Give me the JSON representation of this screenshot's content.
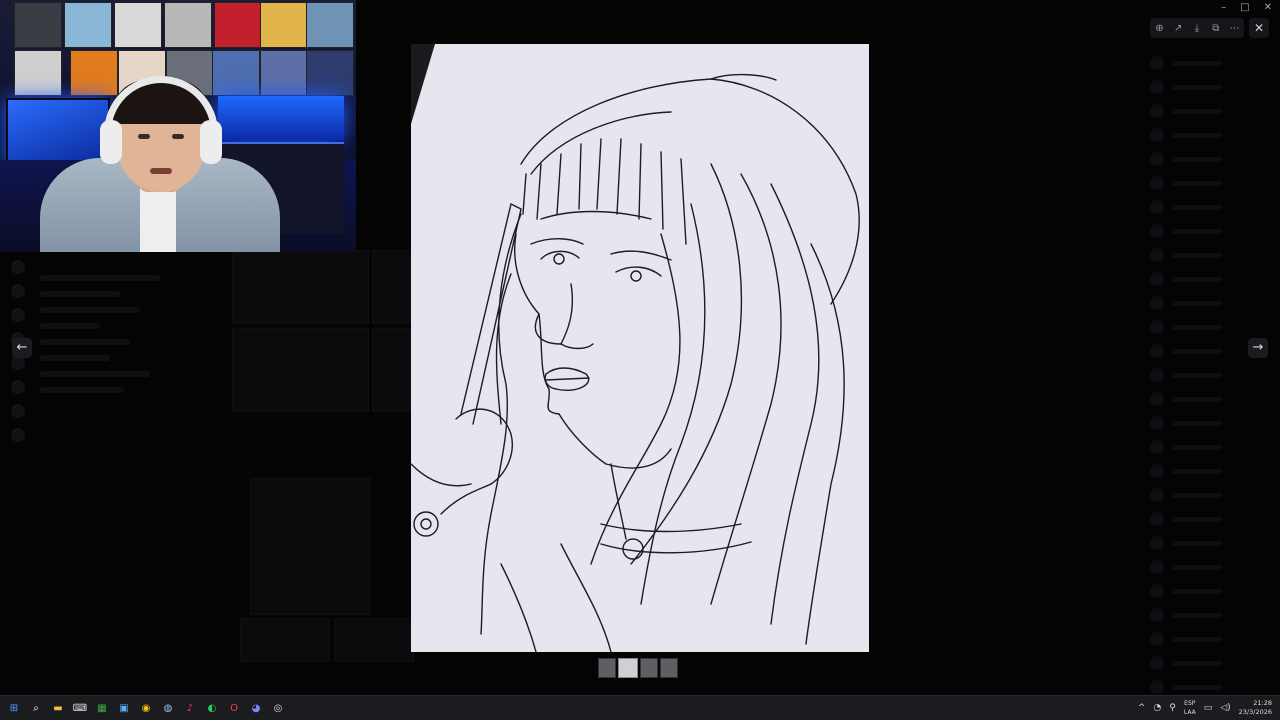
{
  "viewer": {
    "prev_label": "←",
    "next_label": "→",
    "close_label": "✕",
    "toolbar": [
      {
        "icon": "zoom-icon",
        "glyph": "⊕"
      },
      {
        "icon": "forward-icon",
        "glyph": "↗"
      },
      {
        "icon": "download-icon",
        "glyph": "⤓"
      },
      {
        "icon": "open-external-icon",
        "glyph": "⧉"
      },
      {
        "icon": "more-icon",
        "glyph": "⋯"
      }
    ],
    "thumbnail_count": 4,
    "selected_thumbnail": 2
  },
  "window_controls": {
    "minimize": "–",
    "maximize": "□",
    "close": "✕"
  },
  "taskbar": {
    "apps": [
      {
        "icon": "windows-start-icon",
        "glyph": "⊞",
        "color": "#4aa3ff"
      },
      {
        "icon": "search-icon",
        "glyph": "⌕",
        "color": "#ffffff"
      },
      {
        "icon": "file-explorer-icon",
        "glyph": "▬",
        "color": "#f5c242"
      },
      {
        "icon": "keyboard-app-icon",
        "glyph": "⌨",
        "color": "#dddddd"
      },
      {
        "icon": "minecraft-icon",
        "glyph": "▦",
        "color": "#3faa3a"
      },
      {
        "icon": "photos-icon",
        "glyph": "▣",
        "color": "#5fb0ff"
      },
      {
        "icon": "chrome-icon",
        "glyph": "◉",
        "color": "#f4c20d"
      },
      {
        "icon": "steam-icon",
        "glyph": "◍",
        "color": "#9ec3e8"
      },
      {
        "icon": "tiktok-icon",
        "glyph": "♪",
        "color": "#ff2d6f"
      },
      {
        "icon": "spotify-icon",
        "glyph": "◐",
        "color": "#1ed760"
      },
      {
        "icon": "opera-icon",
        "glyph": "O",
        "color": "#ff3b4a"
      },
      {
        "icon": "discord-icon",
        "glyph": "◕",
        "color": "#7a87ff"
      },
      {
        "icon": "obs-icon",
        "glyph": "◎",
        "color": "#dddddd"
      }
    ],
    "language_top": "ESP",
    "language_bottom": "LAA",
    "time": "21:28",
    "date": "23/3/2026"
  }
}
